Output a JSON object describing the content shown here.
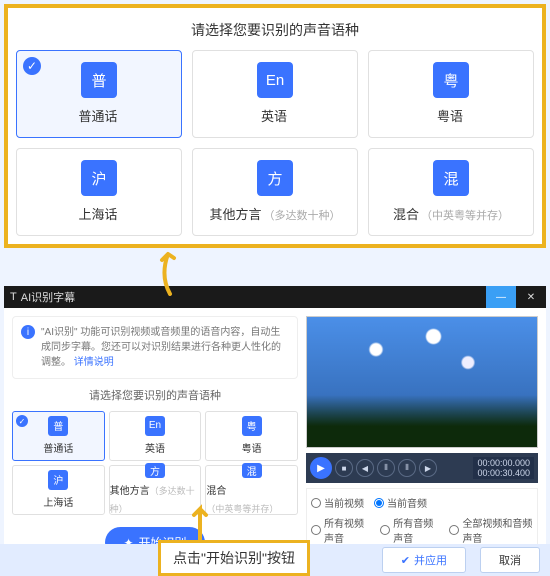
{
  "top": {
    "title": "请选择您要识别的声音语种",
    "langs": [
      {
        "icon": "普",
        "name": "普通话",
        "note": "",
        "selected": true
      },
      {
        "icon": "En",
        "name": "英语",
        "note": "",
        "selected": false
      },
      {
        "icon": "粤",
        "name": "粤语",
        "note": "",
        "selected": false
      },
      {
        "icon": "沪",
        "name": "上海话",
        "note": "",
        "selected": false
      },
      {
        "icon": "方",
        "name": "其他方言",
        "note": "（多达数十种）",
        "selected": false
      },
      {
        "icon": "混",
        "name": "混合",
        "note": "（中英粤等并存）",
        "selected": false
      }
    ]
  },
  "app": {
    "title": "AI识别字幕",
    "info_text": "\"AI识别\" 功能可识别视频或音频里的语音内容，自动生成同步字幕。您还可以对识别结果进行各种更人性化的调整。",
    "info_link": "详情说明",
    "mini_title": "请选择您要识别的声音语种",
    "start_label": "开始识别",
    "time1": "00:00:00.000",
    "time2": "00:00:30.400",
    "opts_r1": [
      {
        "label": "当前视频",
        "checked": false
      },
      {
        "label": "当前音频",
        "checked": true
      }
    ],
    "opts_r2": [
      {
        "label": "所有视频声音",
        "checked": false
      },
      {
        "label": "所有音频声音",
        "checked": false
      },
      {
        "label": "全部视频和音频声音",
        "checked": false
      }
    ],
    "btn_apply": "并应用",
    "btn_cancel": "取消"
  },
  "callout": "点击\"开始识别\"按钮"
}
